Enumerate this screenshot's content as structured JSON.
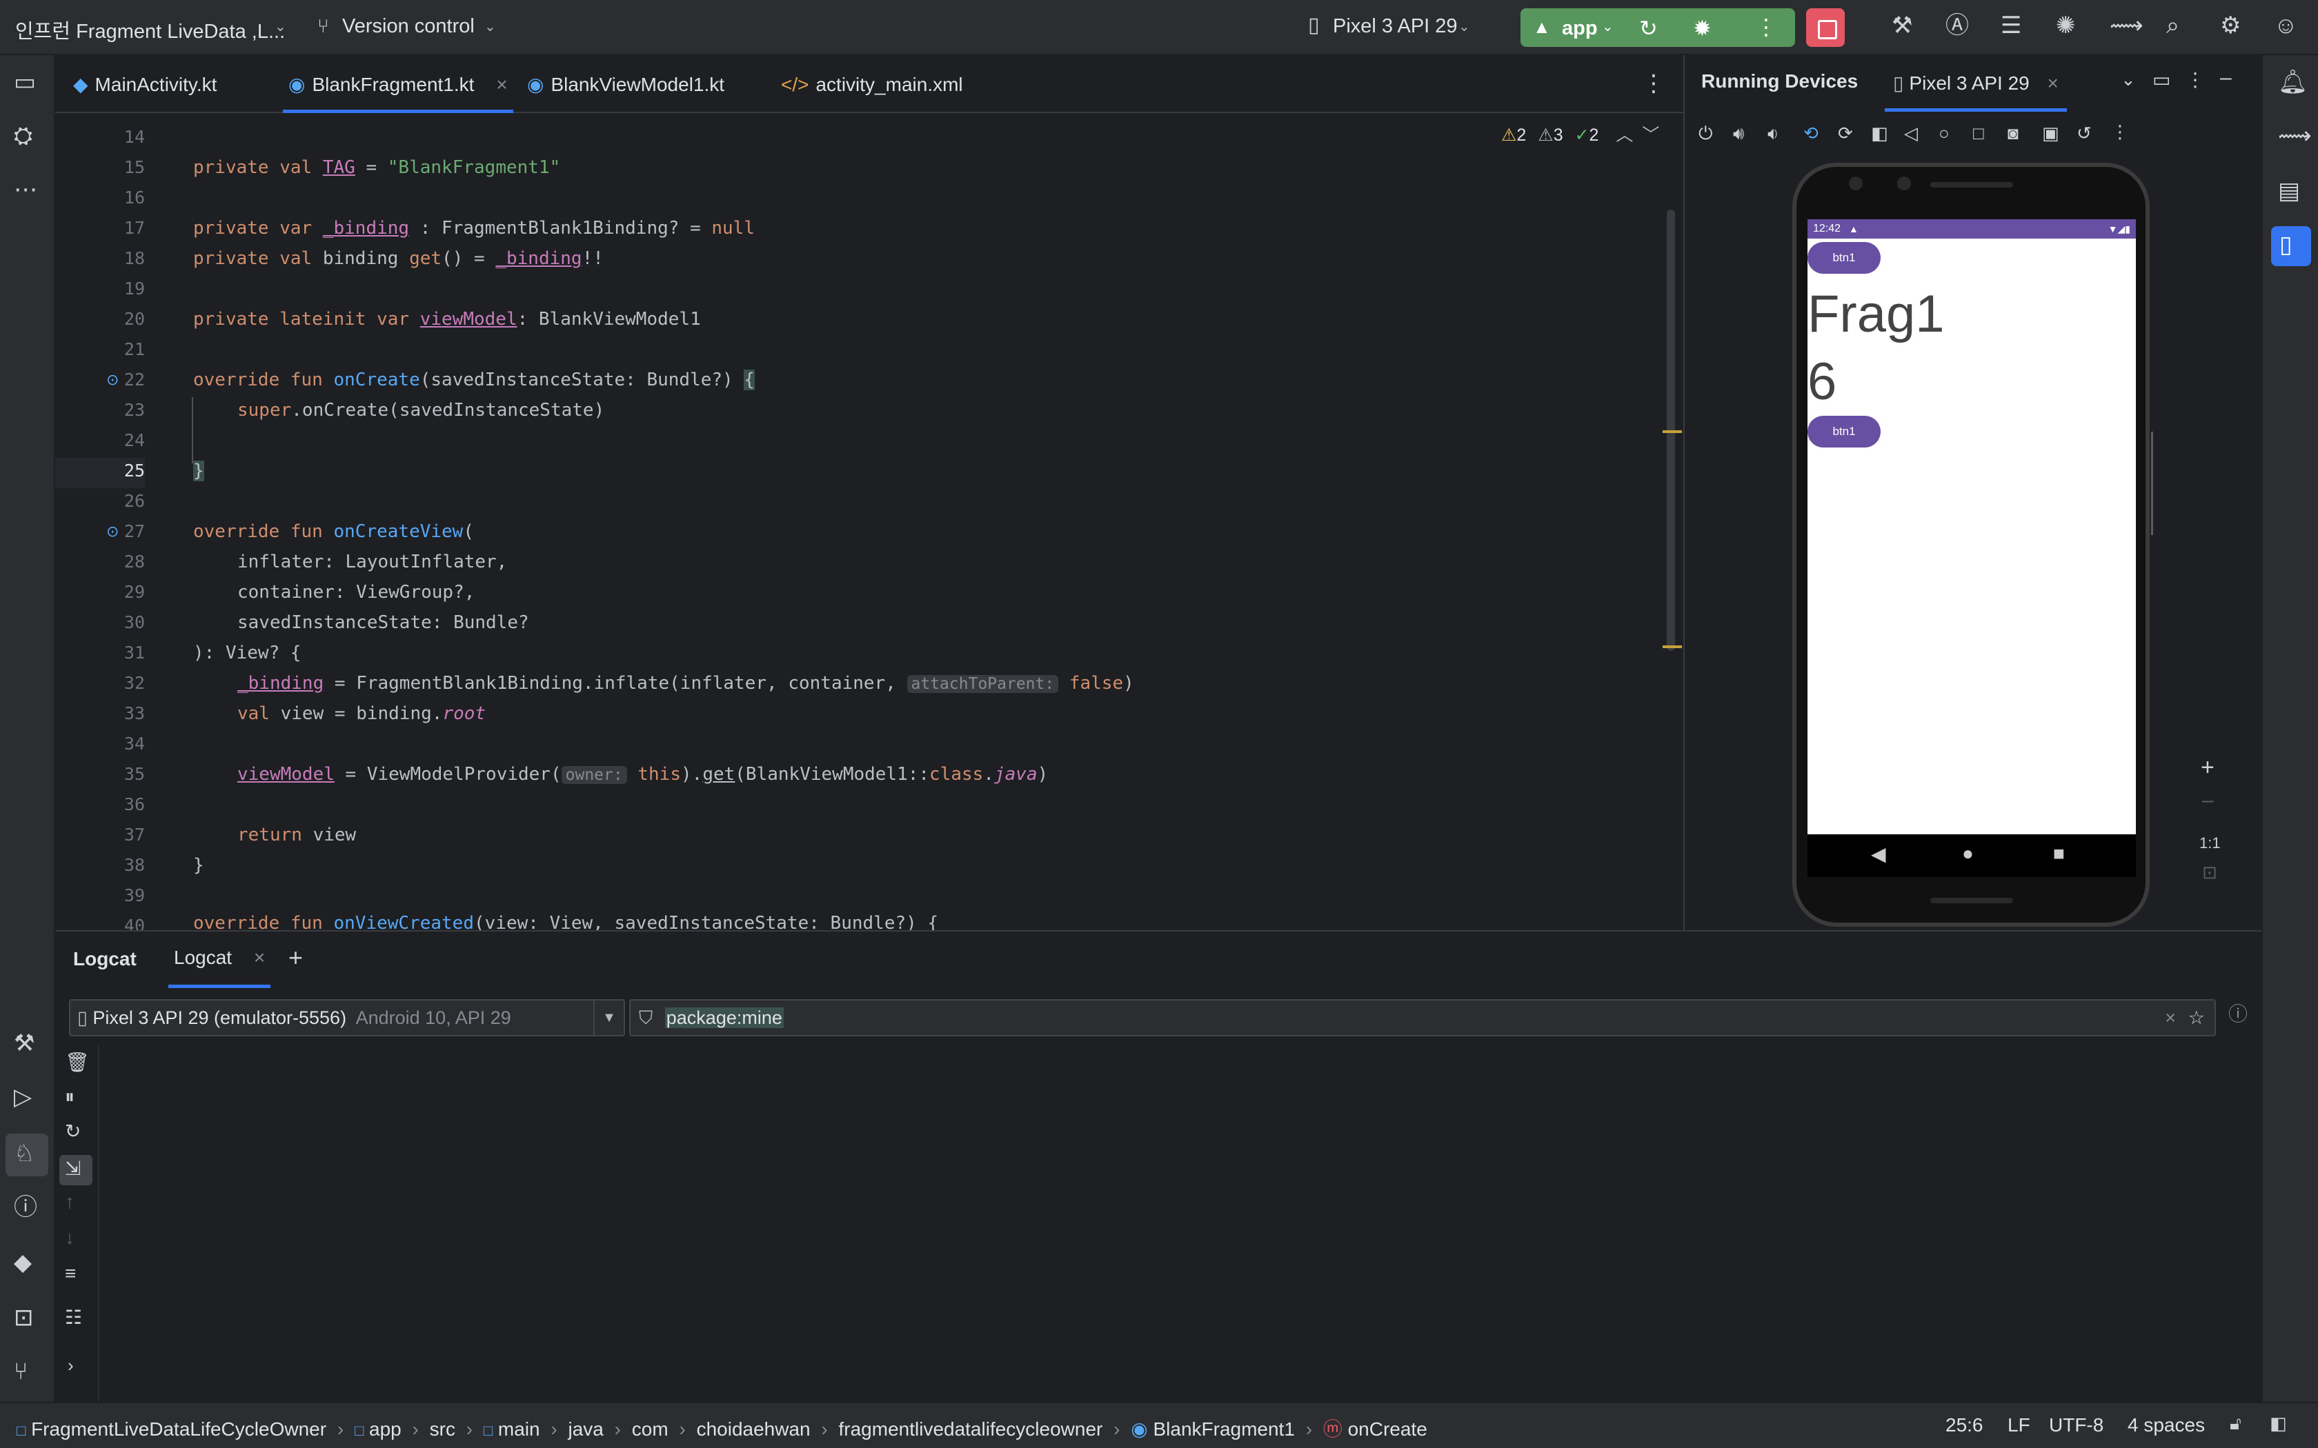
{
  "titlebar": {
    "project": "인프런 Fragment LiveData ,L...",
    "vcs": "Version control",
    "device": "Pixel 3 API 29",
    "run_config": "app"
  },
  "editor_tabs": [
    {
      "label": "MainActivity.kt"
    },
    {
      "label": "BlankFragment1.kt"
    },
    {
      "label": "BlankViewModel1.kt"
    },
    {
      "label": "activity_main.xml"
    }
  ],
  "inspections": {
    "warn1": "2",
    "warn2": "3",
    "ok": "2"
  },
  "code": {
    "line_numbers": [
      "14",
      "15",
      "16",
      "17",
      "18",
      "19",
      "20",
      "21",
      "22",
      "23",
      "24",
      "25",
      "26",
      "27",
      "28",
      "29",
      "30",
      "31",
      "32",
      "33",
      "34",
      "35",
      "36",
      "37",
      "38",
      "39",
      "40"
    ],
    "l15": {
      "a": "private val ",
      "b": "TAG",
      "c": " = ",
      "d": "\"BlankFragment1\""
    },
    "l17": {
      "a": "private var ",
      "b": "_binding",
      "c": " : FragmentBlank1Binding? = ",
      "d": "null"
    },
    "l18": {
      "a": "private val ",
      "b": "binding",
      "c": " ",
      "d": "get",
      "e": "() = ",
      "f": "_binding",
      "g": "!!"
    },
    "l20": {
      "a": "private lateinit var ",
      "b": "viewModel",
      "c": ": BlankViewModel1"
    },
    "l22": {
      "a": "override fun ",
      "b": "onCreate",
      "c": "(savedInstanceState: Bundle?) ",
      "d": "{"
    },
    "l23": {
      "a": "super",
      "b": ".onCreate(savedInstanceState)"
    },
    "l25": {
      "a": "}"
    },
    "l27": {
      "a": "override fun ",
      "b": "onCreateView",
      "c": "("
    },
    "l28": {
      "a": "inflater: LayoutInflater,"
    },
    "l29": {
      "a": "container: ViewGroup?,"
    },
    "l30": {
      "a": "savedInstanceState: Bundle?"
    },
    "l31": {
      "a": "): View? {"
    },
    "l32": {
      "a": "_binding",
      "b": " = FragmentBlank1Binding.inflate(inflater, container, ",
      "hint": "attachToParent:",
      "c": " false",
      "d": ")"
    },
    "l33": {
      "a": "val ",
      "b": "view = binding.",
      "c": "root"
    },
    "l35": {
      "a": "viewModel",
      "b": " = ViewModelProvider(",
      "hint": "owner:",
      "c": " this",
      "d": ").",
      "e": "get",
      "f": "(BlankViewModel1::",
      "g": "class",
      "h": ".",
      "i": "java",
      "j": ")"
    },
    "l37": {
      "a": "return ",
      "b": "view"
    },
    "l38": {
      "a": "}"
    },
    "l40": {
      "a": "override fun ",
      "b": "onViewCreated",
      "c": "(view: View, savedInstanceState: Bundle?) {"
    }
  },
  "running_devices": {
    "title": "Running Devices",
    "tab": "Pixel 3 API 29",
    "zoom_label": "1:1"
  },
  "phone": {
    "time": "12:42",
    "btn1_top": "btn1",
    "frag_text": "Frag1",
    "count": "6",
    "btn1_bottom": "btn1"
  },
  "logcat": {
    "title": "Logcat",
    "tab": "Logcat",
    "device_select": "Pixel 3 API 29 (emulator-5556)",
    "device_select_detail": "Android 10, API 29",
    "filter": "package:mine"
  },
  "statusbar": {
    "breadcrumbs": [
      "FragmentLiveDataLifeCycleOwner",
      "app",
      "src",
      "main",
      "java",
      "com",
      "choidaehwan",
      "fragmentlivedatalifecycleowner",
      "BlankFragment1",
      "onCreate"
    ],
    "position": "25:6",
    "line_sep": "LF",
    "encoding": "UTF-8",
    "indent": "4 spaces"
  },
  "colors": {
    "accent": "#3574f0",
    "run": "#57965c",
    "stop": "#e55765",
    "device_primary": "#6750a4"
  }
}
